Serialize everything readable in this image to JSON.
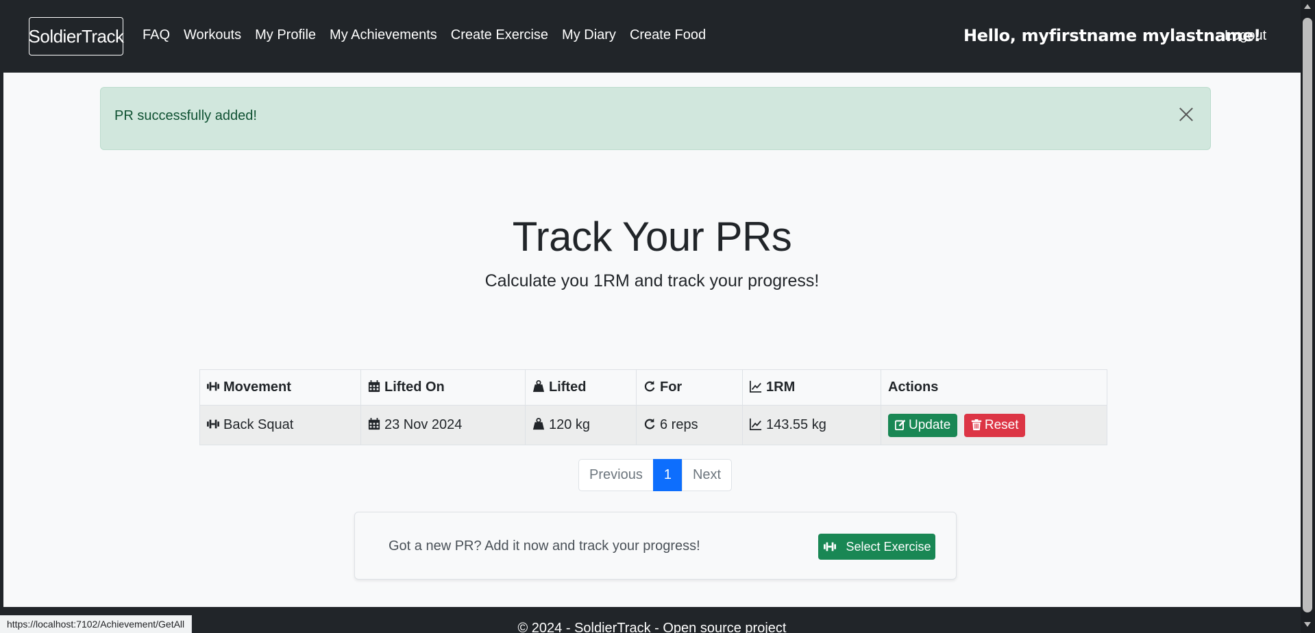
{
  "navbar": {
    "brand": "SoldierTrack",
    "links": [
      "FAQ",
      "Workouts",
      "My Profile",
      "My Achievements",
      "Create Exercise",
      "My Diary",
      "Create Food"
    ],
    "greeting": "Hello, myfirstname mylastname!",
    "logout": "Logout"
  },
  "alert": {
    "message": "PR successfully added!"
  },
  "hero": {
    "title": "Track Your PRs",
    "subtitle": "Calculate you 1RM and track your progress!"
  },
  "table": {
    "headers": [
      "Movement",
      "Lifted On",
      "Lifted",
      "For",
      "1RM",
      "Actions"
    ],
    "rows": [
      {
        "movement": "Back Squat",
        "lifted_on": "23 Nov 2024",
        "lifted": "120 kg",
        "for": "6 reps",
        "one_rm": "143.55 kg"
      }
    ],
    "update_label": "Update",
    "reset_label": "Reset"
  },
  "pagination": {
    "previous": "Previous",
    "current": "1",
    "next": "Next"
  },
  "cta": {
    "text": "Got a new PR? Add it now and track your progress!",
    "button": "Select Exercise"
  },
  "footer": {
    "text": "© 2024 - SoldierTrack - Open source project"
  },
  "statusbar": {
    "url": "https://localhost:7102/Achievement/GetAll"
  }
}
